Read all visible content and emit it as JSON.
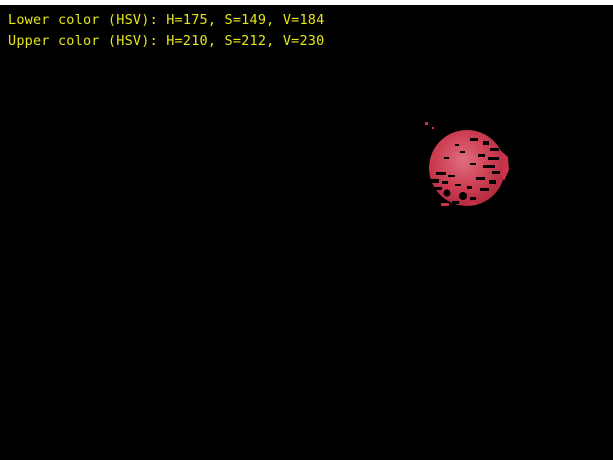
{
  "overlay": {
    "lower_label": "Lower color (HSV): H=175, S=149, V=184",
    "upper_label": "Upper color (HSV): H=210, S=212, V=230"
  },
  "colors": {
    "frame_background": "#000000",
    "overlay_text": "#e6e619",
    "detected_blob": "#c8344a",
    "blob_highlight": "#de6f7e"
  }
}
